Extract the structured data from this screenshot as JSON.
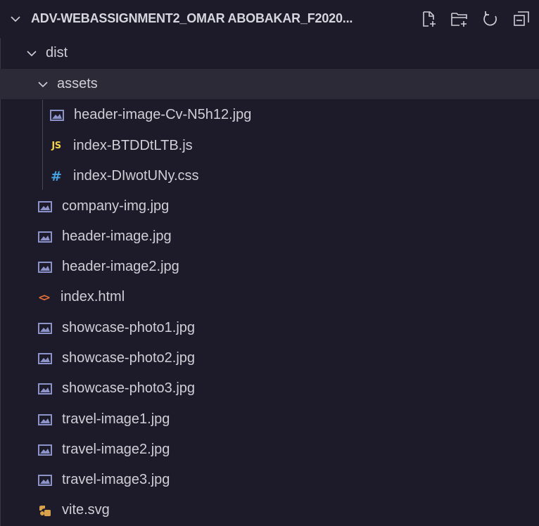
{
  "explorer": {
    "folder_title": "ADV-WEBASSIGNMENT2_OMAR ABOBAKAR_F2020...",
    "actions": [
      {
        "name": "new-file-icon"
      },
      {
        "name": "new-folder-icon"
      },
      {
        "name": "refresh-icon"
      },
      {
        "name": "collapse-all-icon"
      }
    ]
  },
  "tree": {
    "dist": {
      "label": "dist",
      "expanded": true
    },
    "assets": {
      "label": "assets",
      "expanded": true,
      "selected": true
    },
    "assets_files": [
      {
        "label": "header-image-Cv-N5h12.jpg",
        "icon": "image-file-icon"
      },
      {
        "label": "index-BTDDtLTB.js",
        "icon": "js-file-icon",
        "icon_text": "JS"
      },
      {
        "label": "index-DIwotUNy.css",
        "icon": "css-file-icon",
        "icon_text": "#"
      }
    ],
    "dist_files": [
      {
        "label": "company-img.jpg",
        "icon": "image-file-icon"
      },
      {
        "label": "header-image.jpg",
        "icon": "image-file-icon"
      },
      {
        "label": "header-image2.jpg",
        "icon": "image-file-icon"
      },
      {
        "label": "index.html",
        "icon": "html-file-icon",
        "icon_text": "<>"
      },
      {
        "label": "showcase-photo1.jpg",
        "icon": "image-file-icon"
      },
      {
        "label": "showcase-photo2.jpg",
        "icon": "image-file-icon"
      },
      {
        "label": "showcase-photo3.jpg",
        "icon": "image-file-icon"
      },
      {
        "label": "travel-image1.jpg",
        "icon": "image-file-icon"
      },
      {
        "label": "travel-image2.jpg",
        "icon": "image-file-icon"
      },
      {
        "label": "travel-image3.jpg",
        "icon": "image-file-icon"
      },
      {
        "label": "vite.svg",
        "icon": "svg-file-icon"
      }
    ]
  },
  "colors": {
    "background": "#1d1a29",
    "selected_row": "#2c2a37",
    "text": "#cfcfd6",
    "image_icon": "#8b93c9",
    "js_icon": "#f2d04b",
    "css_icon": "#47a2e0",
    "html_icon": "#e2703a",
    "svg_icon": "#d8a24a"
  }
}
